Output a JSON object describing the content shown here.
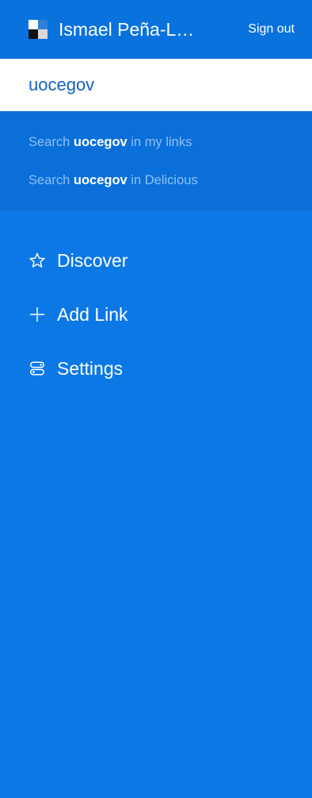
{
  "header": {
    "username": "Ismael Peña-L…",
    "signout_label": "Sign out"
  },
  "search": {
    "value": "uocegov",
    "placeholder": ""
  },
  "suggestions": [
    {
      "prefix": "Search",
      "term": "uocegov",
      "suffix": "in my links"
    },
    {
      "prefix": "Search",
      "term": "uocegov",
      "suffix": "in Delicious"
    }
  ],
  "nav": {
    "items": [
      {
        "label": "Discover",
        "icon": "star-icon"
      },
      {
        "label": "Add Link",
        "icon": "plus-icon"
      },
      {
        "label": "Settings",
        "icon": "settings-icon"
      }
    ]
  },
  "colors": {
    "header_bg": "#0a72dd",
    "suggestions_bg": "#0a6fd9",
    "nav_bg": "#0c78e6",
    "input_text": "#1261c4",
    "suggestion_dim": "#8fc0f4"
  }
}
